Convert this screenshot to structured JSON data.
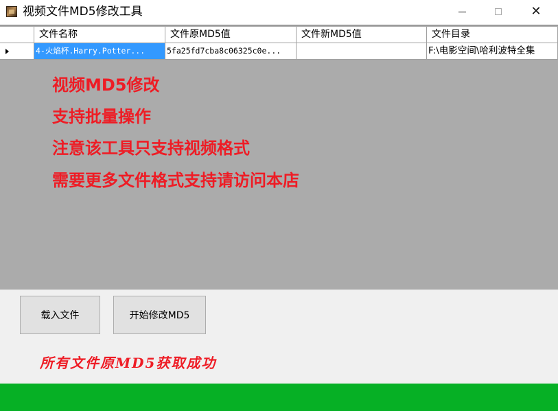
{
  "window": {
    "title": "视频文件MD5修改工具",
    "minimize": "—",
    "maximize": "□",
    "close": "✕"
  },
  "grid": {
    "columns": [
      "文件名称",
      "文件原MD5值",
      "文件新MD5值",
      "文件目录"
    ],
    "rows": [
      {
        "name": "4-火焰杯.Harry.Potter...",
        "original_md5": "5fa25fd7cba8c06325c0e...",
        "new_md5": "",
        "directory": "F:\\电影空间\\哈利波特全集"
      }
    ]
  },
  "overlay": {
    "line1": "视频MD5修改",
    "line2": "支持批量操作",
    "line3": "注意该工具只支持视频格式",
    "line4": "需要更多文件格式支持请访问本店"
  },
  "buttons": {
    "load": "载入文件",
    "start": "开始修改MD5"
  },
  "status": "所有文件原MD5获取成功",
  "progress": {
    "value_percent": 100,
    "color": "#06b025"
  },
  "colors": {
    "accent_red": "#ee1c25",
    "selection": "#3399ff",
    "grid_bg": "#ababab"
  }
}
